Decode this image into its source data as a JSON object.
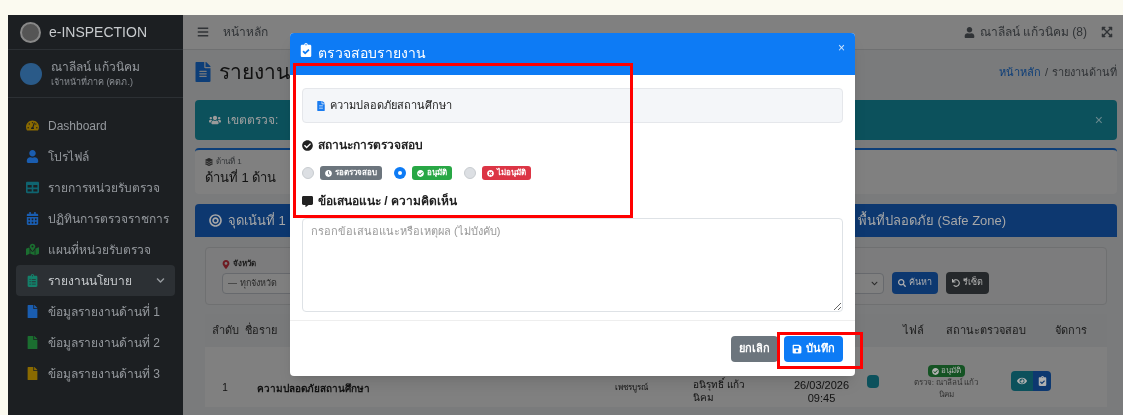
{
  "sidebar": {
    "brand": "e-INSPECTION",
    "user": {
      "name": "ณาลีลน์ แก้วนิคม",
      "role": "เจ้าหน้าที่ภาค (คตภ.)"
    },
    "items": [
      {
        "label": "Dashboard",
        "selected": false,
        "color": "#8a6a00"
      },
      {
        "label": "โปรไฟล์",
        "selected": false,
        "color": "#1a5db0"
      },
      {
        "label": "รายการหน่วยรับตรวจ",
        "selected": false,
        "color": "#0f6470"
      },
      {
        "label": "ปฏิทินการตรวจราชการ",
        "selected": false,
        "color": "#1a5db0"
      },
      {
        "label": "แผนที่หน่วยรับตรวจ",
        "selected": false,
        "color": "#1b6e30"
      },
      {
        "label": "รายงานนโยบาย",
        "selected": true,
        "expanded": true,
        "color": "#14806a",
        "children": [
          {
            "label": "ข้อมูลรายงานด้านที่ 1",
            "selected": false,
            "color": "#1a5db0"
          },
          {
            "label": "ข้อมูลรายงานด้านที่ 2",
            "selected": false,
            "color": "#1b6e30"
          },
          {
            "label": "ข้อมูลรายงานด้านที่ 3",
            "selected": false,
            "color": "#8a6a00"
          }
        ]
      }
    ]
  },
  "topbar": {
    "home": "หน้าหลัก",
    "user": "ณาลีลน์ แก้วนิคม (8)"
  },
  "page": {
    "title": "รายงาน",
    "breadcrumb": [
      "หน้าหลัก",
      "/",
      "รายงานด้านที่"
    ],
    "alert": {
      "text": "เขตตรวจ:",
      "close": "×"
    },
    "aspect": {
      "small": "ด้านที่ 1",
      "title": "ด้านที่ 1 ด้าน"
    },
    "focus": {
      "left": "จุดเน้นที่ 1",
      "right": "พื้นที่ปลอดภัย (Safe Zone)"
    },
    "filter": {
      "label": "จังหวัด",
      "select": "— ทุกจังหวัด",
      "search": "ค้นหา",
      "reset": "รีเซ็ต"
    },
    "table": {
      "columns": [
        "ลำดับ",
        "ชื่อราย",
        "ไฟล์",
        "สถานะตรวจสอบ",
        "จัดการ"
      ],
      "rows": [
        {
          "no": "1",
          "name": "ความปลอดภัยสถานศึกษา",
          "province": "เพชรบูรณ์",
          "reporter": "อนิรุทธิ์ แก้ว นิคม",
          "date": "26/03/2026",
          "time": "09:45",
          "status": "อนุมัติ",
          "checker": "ตรวจ: ณาลีลน์ แก้ว นิคม"
        }
      ]
    }
  },
  "modal": {
    "title": "ตรวจสอบรายงาน",
    "close": "×",
    "report": "ความปลอดภัยสถานศึกษา",
    "status_label": "สถานะการตรวจสอบ",
    "options": [
      {
        "kind": "pending",
        "label": "รอตรวจสอบ",
        "selected": false,
        "color": "#6c757d"
      },
      {
        "kind": "approved",
        "label": "อนุมัติ",
        "selected": true,
        "color": "#28a745"
      },
      {
        "kind": "rejected",
        "label": "ไม่อนุมัติ",
        "selected": false,
        "color": "#dc3545"
      }
    ],
    "comment_label": "ข้อเสนอแนะ / ความคิดเห็น",
    "placeholder": "กรอกข้อเสนอแนะหรือเหตุผล (ไม่บังคับ)",
    "cancel": "ยกเลิก",
    "save": "บันทึก"
  }
}
